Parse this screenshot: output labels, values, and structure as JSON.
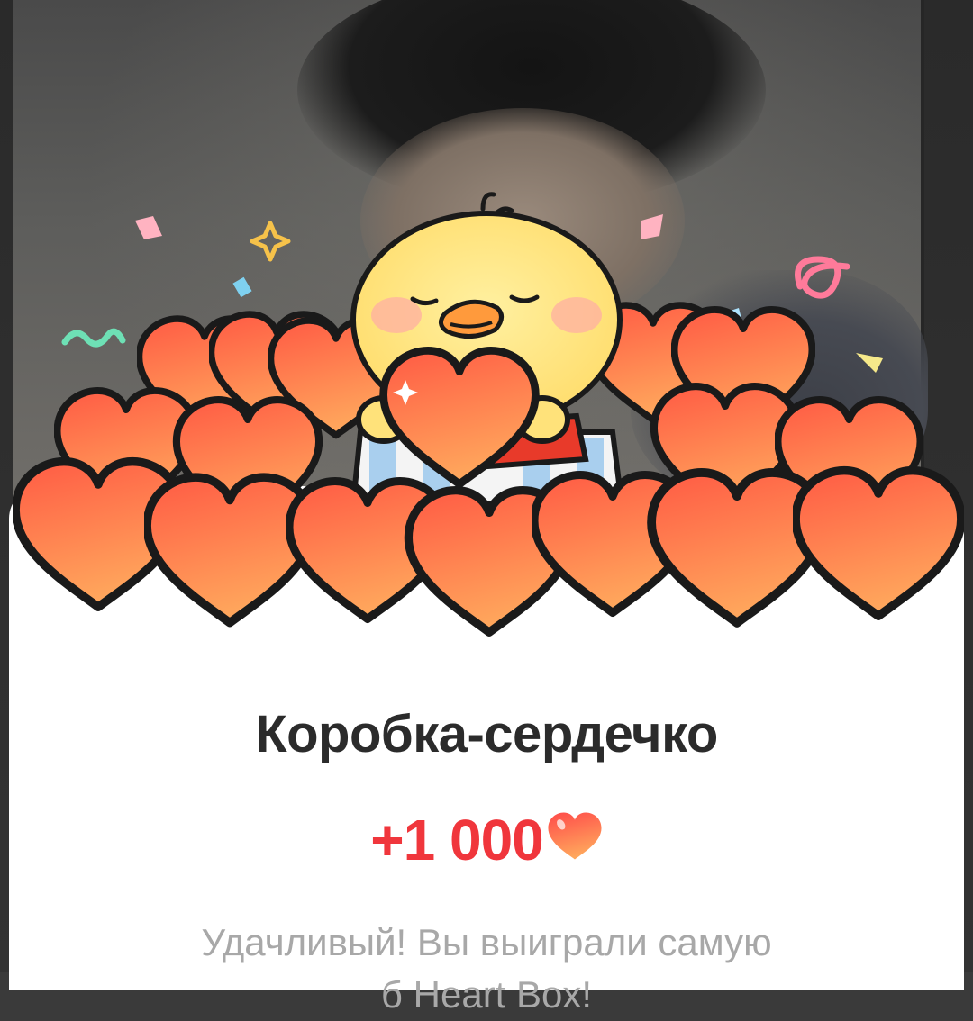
{
  "popup": {
    "title": "Коробка-сердечко",
    "reward_amount": "+1 000",
    "reward_icon": "heart-icon",
    "description": "Удачливый! Вы выиграли самую",
    "description_line2": "б                                   Heart Box!"
  },
  "colors": {
    "reward": "#f0363c",
    "title": "#2b2b2b",
    "description": "#a8a8a8",
    "heart_fill_top": "#ff6b4a",
    "heart_fill_bottom": "#ff9a5a",
    "chick": "#ffe27a"
  }
}
